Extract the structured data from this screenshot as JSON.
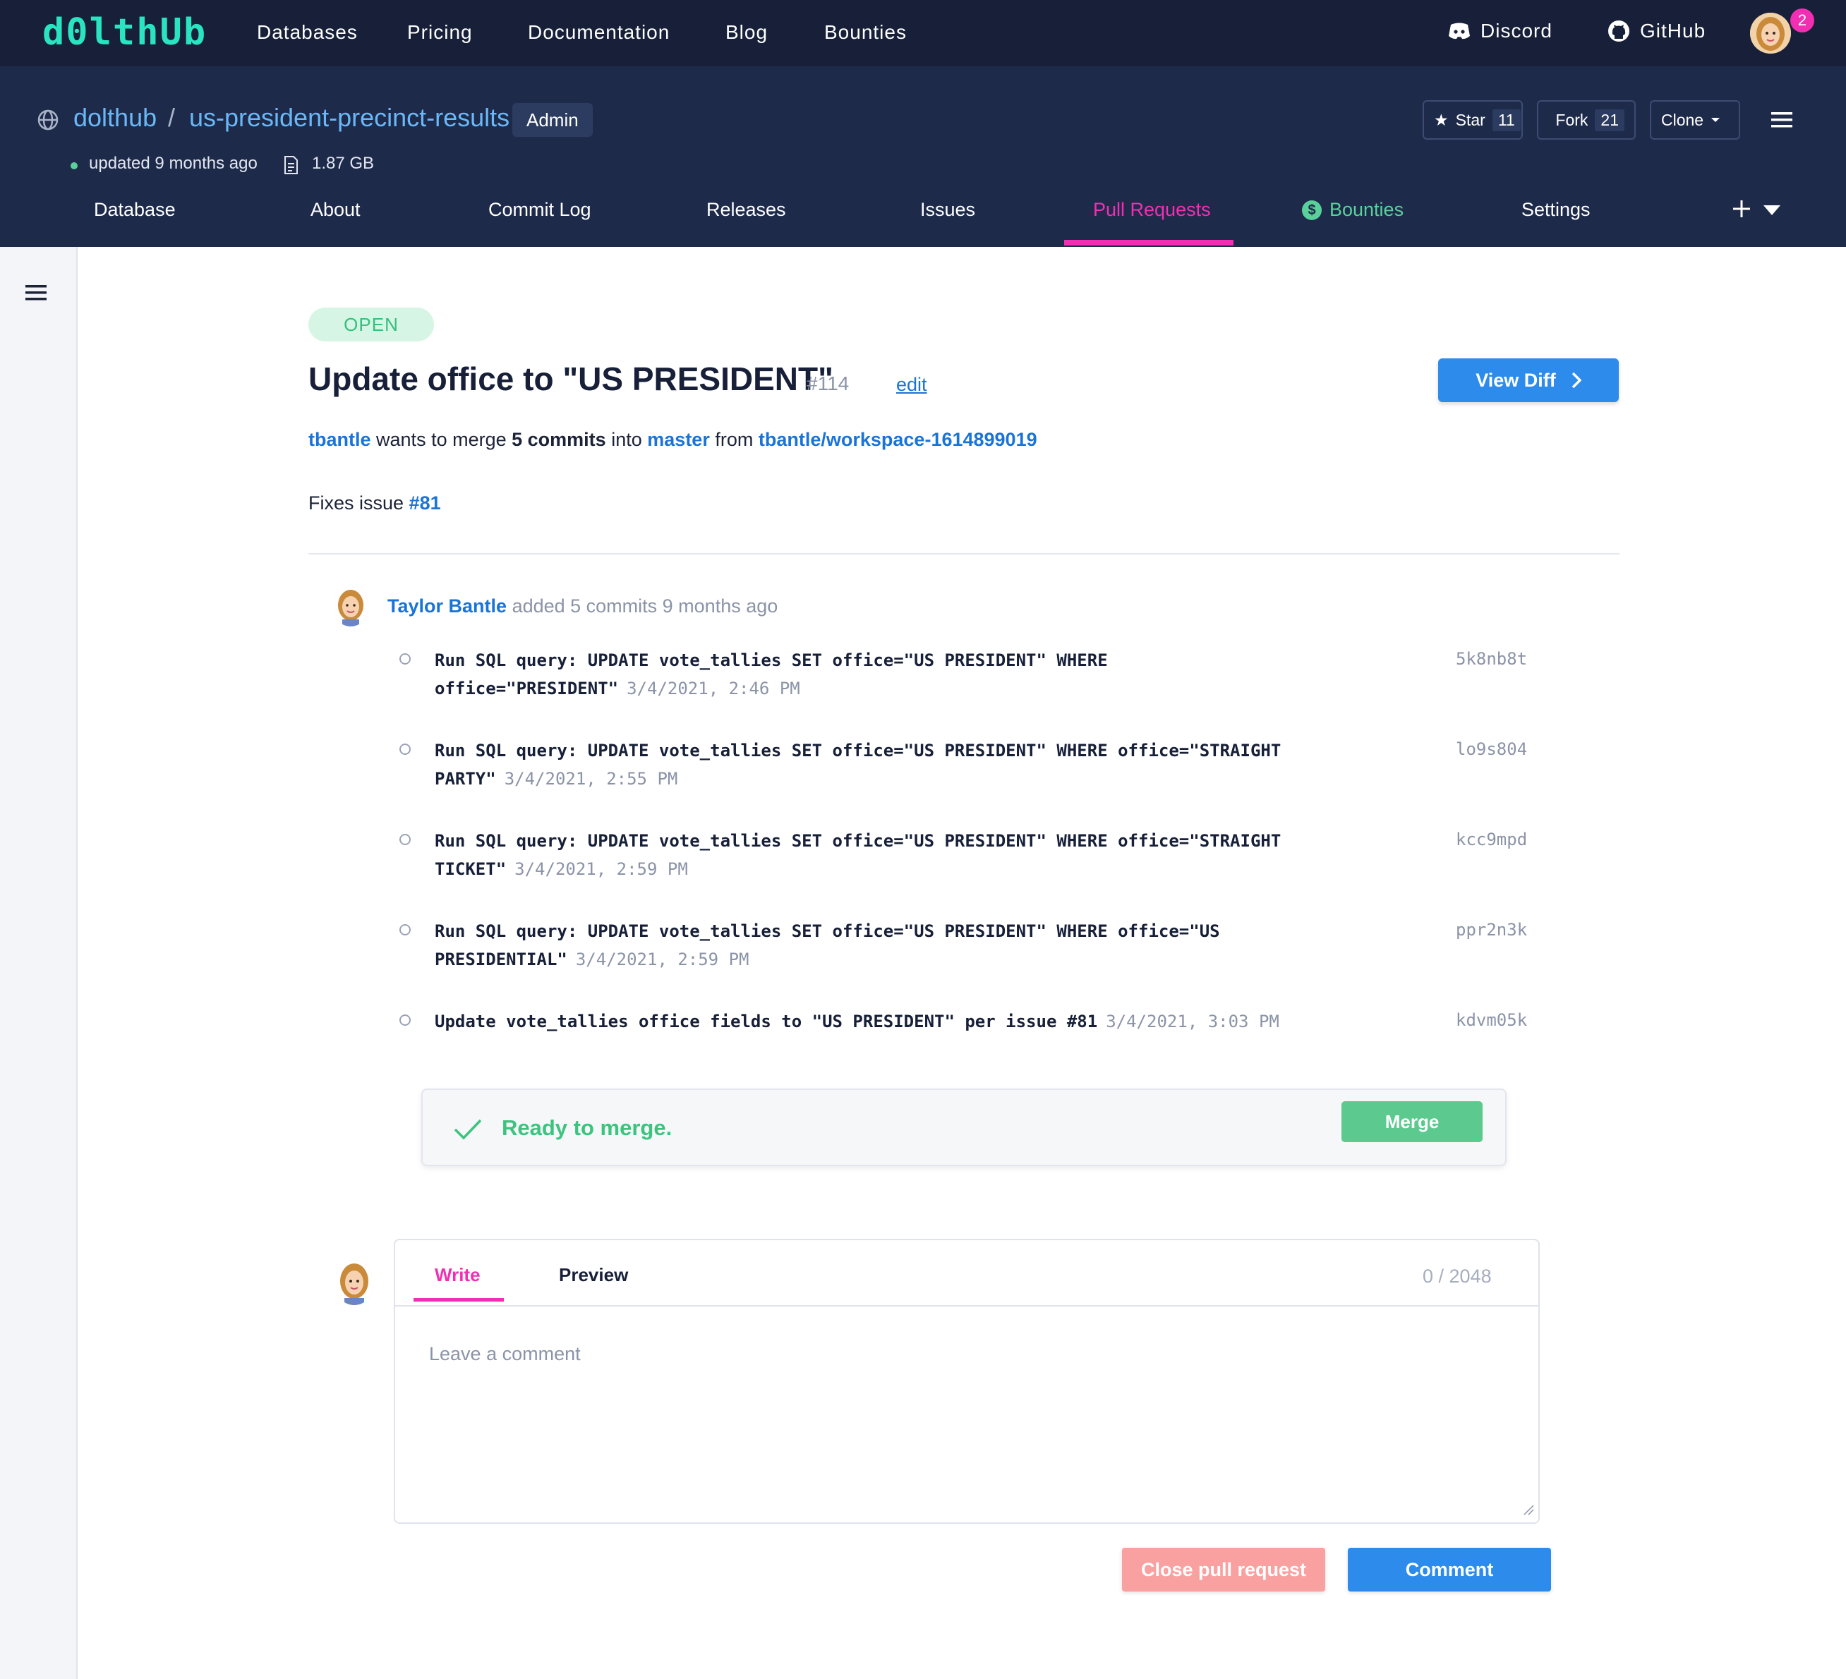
{
  "topnav": {
    "logo": "d0lthUb",
    "links": [
      "Databases",
      "Pricing",
      "Documentation",
      "Blog",
      "Bounties"
    ],
    "discord": "Discord",
    "github": "GitHub",
    "notifications": "2"
  },
  "repo": {
    "owner": "dolthub",
    "separator": "/",
    "name": "us-president-precinct-results",
    "role": "Admin",
    "updated": "updated 9 months ago",
    "size": "1.87 GB",
    "star_label": "Star",
    "star_count": "11",
    "fork_label": "Fork",
    "fork_count": "21",
    "clone_label": "Clone"
  },
  "tabs": [
    {
      "label": "Database"
    },
    {
      "label": "About"
    },
    {
      "label": "Commit Log"
    },
    {
      "label": "Releases"
    },
    {
      "label": "Issues"
    },
    {
      "label": "Pull Requests",
      "active": true
    },
    {
      "label": "Bounties"
    },
    {
      "label": "Settings"
    }
  ],
  "pr": {
    "status": "OPEN",
    "title": "Update office to \"US PRESIDENT\"",
    "number": "#114",
    "edit": "edit",
    "view_diff": "View Diff",
    "author_handle": "tbantle",
    "merge_text_1": "wants to merge",
    "commit_count": "5 commits",
    "merge_text_2": "into",
    "target_branch": "master",
    "merge_text_3": "from",
    "source_branch": "tbantle/workspace-1614899019",
    "description_prefix": "Fixes issue",
    "description_issue": "#81"
  },
  "commits_header": {
    "author": "Taylor Bantle",
    "text": "added 5 commits 9 months ago"
  },
  "commits": [
    {
      "message": "Run SQL query: UPDATE vote_tallies SET office=\"US PRESIDENT\" WHERE office=\"PRESIDENT\"",
      "date": "3/4/2021, 2:46 PM",
      "hash": "5k8nb8t"
    },
    {
      "message": "Run SQL query: UPDATE vote_tallies SET office=\"US PRESIDENT\" WHERE office=\"STRAIGHT PARTY\"",
      "date": "3/4/2021, 2:55 PM",
      "hash": "lo9s804"
    },
    {
      "message": "Run SQL query: UPDATE vote_tallies SET office=\"US PRESIDENT\" WHERE office=\"STRAIGHT TICKET\"",
      "date": "3/4/2021, 2:59 PM",
      "hash": "kcc9mpd"
    },
    {
      "message": "Run SQL query: UPDATE vote_tallies SET office=\"US PRESIDENT\" WHERE office=\"US PRESIDENTIAL\"",
      "date": "3/4/2021, 2:59 PM",
      "hash": "ppr2n3k"
    },
    {
      "message": "Update vote_tallies office fields to \"US PRESIDENT\" per issue #81",
      "date": "3/4/2021, 3:03 PM",
      "hash": "kdvm05k"
    }
  ],
  "merge_box": {
    "status": "Ready to merge.",
    "button": "Merge"
  },
  "comment": {
    "tab_write": "Write",
    "tab_preview": "Preview",
    "char_count": "0 / 2048",
    "placeholder": "Leave a comment",
    "close_button": "Close pull request",
    "comment_button": "Comment"
  },
  "colors": {
    "nav_bg": "#172038",
    "header_bg": "#1e2a4a",
    "accent_pink": "#f22fb3",
    "link_blue": "#1a74d7",
    "button_blue": "#2d8ceb",
    "success_green": "#3cc47f",
    "logo_teal": "#29e3c1"
  },
  "icons": [
    "discord-icon",
    "github-icon",
    "globe-icon",
    "database-size-icon",
    "star-icon",
    "fork-icon",
    "caret-down-icon",
    "hamburger-icon",
    "dollar-icon",
    "plus-icon",
    "chevron-right-icon",
    "check-icon",
    "avatar"
  ]
}
